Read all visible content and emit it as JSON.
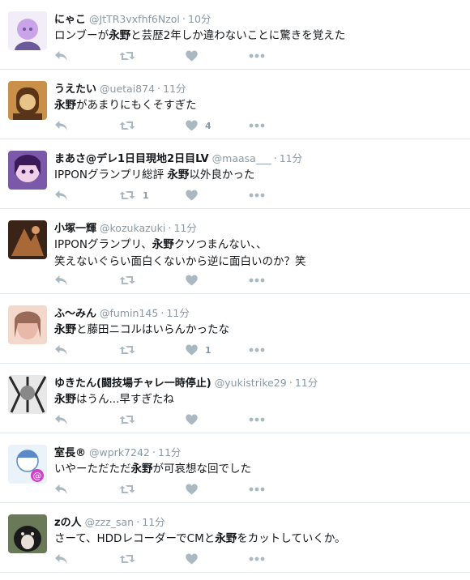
{
  "tweets": [
    {
      "fullname": "にゃこ",
      "username": "@JtTR3vxfhf6Nzol",
      "time": "10分",
      "lines": [
        [
          "ロンブーが",
          "",
          "と芸歴2年しか違わないことに驚きを覚えた"
        ]
      ],
      "keyword": "永野",
      "retweets": "",
      "likes": "",
      "avatar": {
        "bg": "#f2eef8",
        "fg": "#6a5a9a",
        "accent": "#c9a4e8"
      }
    },
    {
      "fullname": "うえたい",
      "username": "@uetai874",
      "time": "11分",
      "lines": [
        [
          "",
          "",
          "があまりにもくそすぎた"
        ]
      ],
      "keyword": "永野",
      "retweets": "",
      "likes": "4",
      "avatar": {
        "bg": "#c89048",
        "fg": "#5a3418",
        "accent": "#e8c488"
      }
    },
    {
      "fullname": "まあさ@デレ1日目現地2日目LV",
      "username": "@maasa___",
      "time": "11分",
      "lines": [
        [
          "IPPONグランプリ総評 ",
          "",
          "以外良かった"
        ]
      ],
      "keyword": "永野",
      "retweets": "1",
      "likes": "",
      "avatar": {
        "bg": "#7a5aa8",
        "fg": "#3a1a58",
        "accent": "#f0d0e8"
      }
    },
    {
      "fullname": "小塚一輝",
      "username": "@kozukazuki",
      "time": "11分",
      "lines": [
        [
          "IPPONグランプリ、",
          "",
          "クソつまんない、、"
        ],
        [
          "笑えないぐらい面白くないから逆に面白いのか？笑",
          "",
          ""
        ]
      ],
      "keyword": "永野",
      "retweets": "",
      "likes": "",
      "avatar": {
        "bg": "#3a2418",
        "fg": "#a86838",
        "accent": "#d89868"
      }
    },
    {
      "fullname": "ふ〜みん",
      "username": "@fumin145",
      "time": "11分",
      "lines": [
        [
          "",
          "",
          "と藤田ニコルはいらんかったな"
        ]
      ],
      "keyword": "永野",
      "retweets": "",
      "likes": "1",
      "avatar": {
        "bg": "#f4d8cc",
        "fg": "#9a6a58",
        "accent": "#e8b8a8"
      }
    },
    {
      "fullname": "ゆきたん(闘技場チャレ一時停止)",
      "username": "@yukistrike29",
      "time": "11分",
      "lines": [
        [
          "",
          "",
          "はうん...早すぎたね"
        ]
      ],
      "keyword": "永野",
      "retweets": "",
      "likes": "",
      "avatar": {
        "bg": "#e8e8e8",
        "fg": "#2a2a2a",
        "accent": "#888888"
      }
    },
    {
      "fullname": "室長®",
      "username": "@wprk7242",
      "time": "11分",
      "lines": [
        [
          "いやーただただ",
          "",
          "が可哀想な回でした"
        ]
      ],
      "keyword": "永野",
      "retweets": "",
      "likes": "",
      "avatar": {
        "bg": "#eaf2fa",
        "fg": "#5a8ac8",
        "accent": "#d040c8"
      }
    },
    {
      "fullname": "zの人",
      "username": "@zzz_san",
      "time": "11分",
      "lines": [
        [
          "さーて、HDDレコーダーでCMと",
          "",
          "をカットしていくか。"
        ]
      ],
      "keyword": "永野",
      "retweets": "",
      "likes": "",
      "avatar": {
        "bg": "#6a7a58",
        "fg": "#1a1a1a",
        "accent": "#e8e0d8"
      }
    }
  ],
  "separator": "·",
  "icons": {
    "reply": "reply-icon",
    "retweet": "retweet-icon",
    "like": "heart-icon",
    "more": "more-dots-icon"
  },
  "colors": {
    "action": "#aab8c2",
    "meta": "#8899a6",
    "border": "#e1e8ed"
  }
}
